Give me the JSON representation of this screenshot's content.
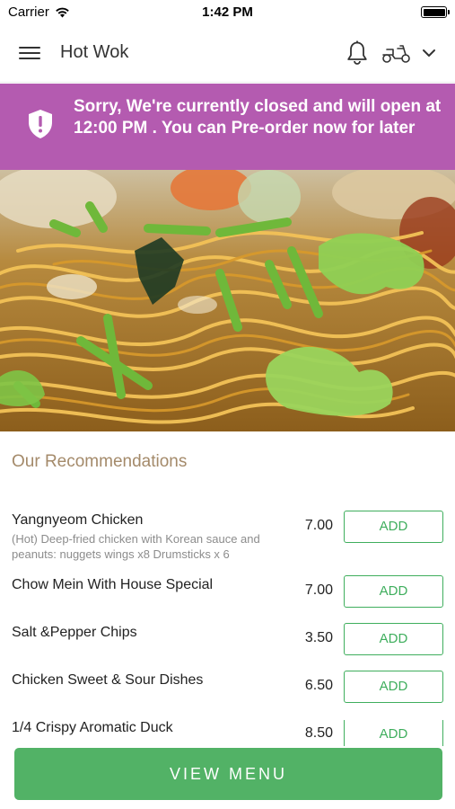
{
  "status_bar": {
    "carrier": "Carrier",
    "time": "1:42 PM"
  },
  "header": {
    "title": "Hot Wok"
  },
  "banner": {
    "message": "Sorry, We're currently closed and will open at 12:00 PM . You can Pre-order now for later",
    "color": "#b45bb0"
  },
  "recommendations": {
    "title": "Our Recommendations",
    "items": [
      {
        "name": "Yangnyeom Chicken",
        "description": "(Hot) Deep-fried chicken with Korean sauce and peanuts:  nuggets  wings x8  Drumsticks x 6",
        "price": "7.00",
        "add_label": "ADD"
      },
      {
        "name": "Chow Mein With House Special",
        "price": "7.00",
        "add_label": "ADD"
      },
      {
        "name": "Salt &Pepper Chips",
        "price": "3.50",
        "add_label": "ADD"
      },
      {
        "name": "Chicken Sweet & Sour Dishes",
        "price": "6.50",
        "add_label": "ADD"
      },
      {
        "name": "1/4 Crispy Aromatic Duck",
        "price": "8.50",
        "add_label": "ADD"
      }
    ]
  },
  "footer": {
    "view_menu_label": "VIEW MENU",
    "accent_color": "#52b266"
  },
  "icons": {
    "menu": "hamburger-menu-icon",
    "notifications": "bell-icon",
    "delivery": "scooter-icon",
    "dropdown": "chevron-down-icon",
    "banner": "shield-alert-icon",
    "wifi": "wifi-icon",
    "battery": "battery-icon"
  }
}
